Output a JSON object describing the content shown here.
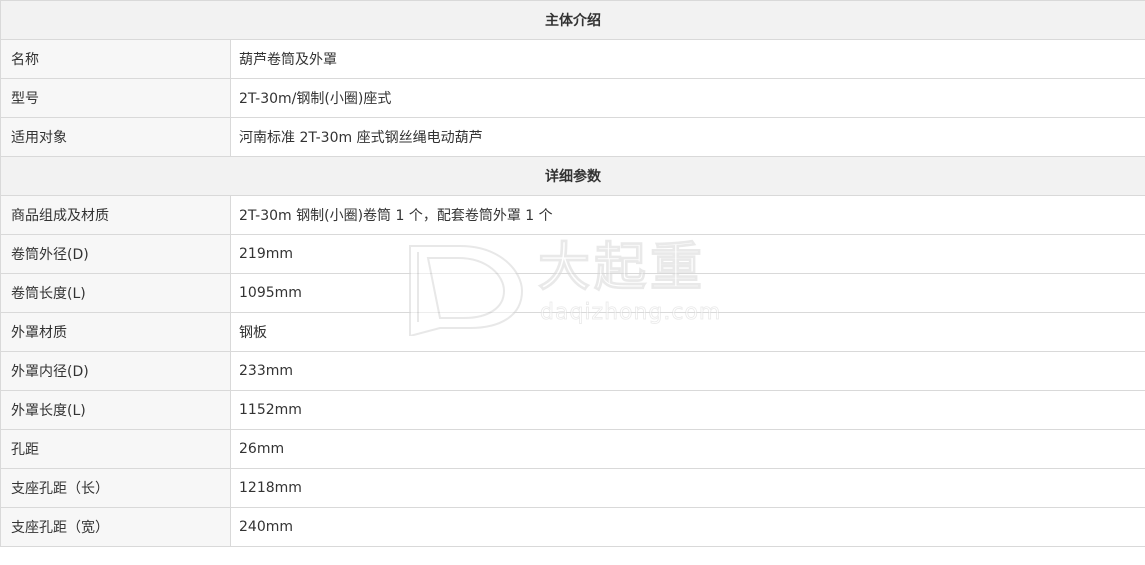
{
  "sections": [
    {
      "title": "主体介绍",
      "rows": [
        {
          "label": "名称",
          "value": "葫芦卷筒及外罩"
        },
        {
          "label": "型号",
          "value": "2T-30m/钢制(小圈)座式"
        },
        {
          "label": "适用对象",
          "value": "河南标准 2T-30m 座式钢丝绳电动葫芦"
        }
      ]
    },
    {
      "title": "详细参数",
      "rows": [
        {
          "label": "商品组成及材质",
          "value": "2T-30m 钢制(小圈)卷筒 1 个，配套卷筒外罩 1 个"
        },
        {
          "label": "卷筒外径(D)",
          "value": "219mm"
        },
        {
          "label": "卷筒长度(L)",
          "value": "1095mm"
        },
        {
          "label": "外罩材质",
          "value": "钢板"
        },
        {
          "label": "外罩内径(D)",
          "value": "233mm"
        },
        {
          "label": "外罩长度(L)",
          "value": "1152mm"
        },
        {
          "label": "孔距",
          "value": "26mm"
        },
        {
          "label": "支座孔距（长）",
          "value": "1218mm"
        },
        {
          "label": "支座孔距（宽）",
          "value": "240mm"
        }
      ]
    }
  ],
  "watermark": {
    "brand_cn": "大起重",
    "brand_en": "daqizhong.com"
  }
}
